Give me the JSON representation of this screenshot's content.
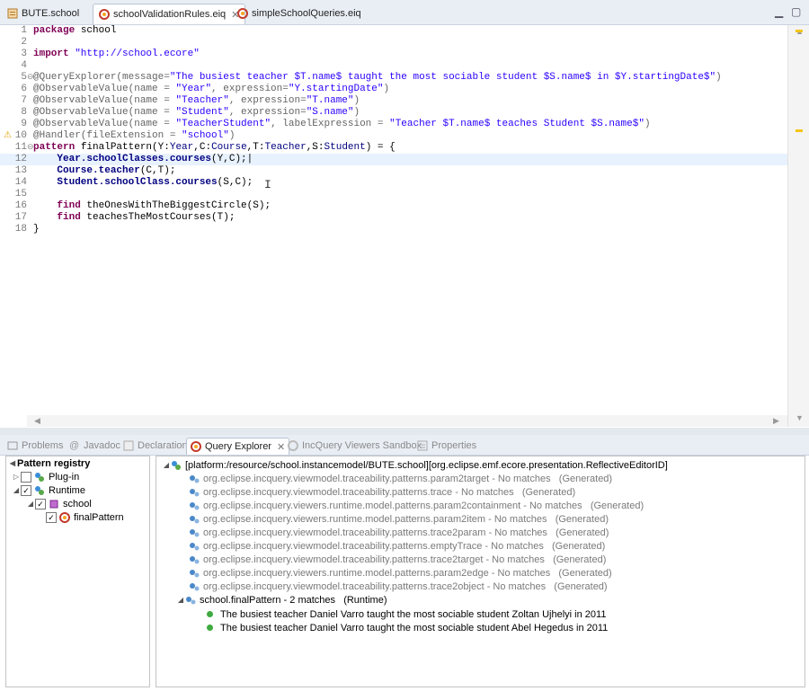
{
  "tabs": [
    {
      "label": "BUTE.school"
    },
    {
      "label": "schoolValidationRules.eiq"
    },
    {
      "label": "simpleSchoolQueries.eiq"
    }
  ],
  "editor": {
    "lines": [
      {
        "n": "1"
      },
      {
        "n": "2"
      },
      {
        "n": "3"
      },
      {
        "n": "4"
      },
      {
        "n": "5"
      },
      {
        "n": "6"
      },
      {
        "n": "7"
      },
      {
        "n": "8"
      },
      {
        "n": "9"
      },
      {
        "n": "10"
      },
      {
        "n": "11"
      },
      {
        "n": "12"
      },
      {
        "n": "13"
      },
      {
        "n": "14"
      },
      {
        "n": "15"
      },
      {
        "n": "16"
      },
      {
        "n": "17"
      },
      {
        "n": "18"
      }
    ],
    "t": {
      "package_kw": "package",
      "package_name": " school",
      "import_kw": "import",
      "import_str": " \"http://school.ecore\"",
      "l5a": "@QueryExplorer(message=",
      "l5b": "\"The busiest teacher $T.name$ taught the most sociable student $S.name$ in $Y.startingDate$\"",
      "l5c": ")",
      "l6a": "@ObservableValue(name = ",
      "l6b": "\"Year\"",
      "l6c": ", expression=",
      "l6d": "\"Y.startingDate\"",
      "l6e": ")",
      "l7a": "@ObservableValue(name = ",
      "l7b": "\"Teacher\"",
      "l7c": ", expression=",
      "l7d": "\"T.name\"",
      "l7e": ")",
      "l8a": "@ObservableValue(name = ",
      "l8b": "\"Student\"",
      "l8c": ", expression=",
      "l8d": "\"S.name\"",
      "l8e": ")",
      "l9a": "@ObservableValue(name = ",
      "l9b": "\"TeacherStudent\"",
      "l9c": ", labelExpression = ",
      "l9d": "\"Teacher $T.name$ teaches Student $S.name$\"",
      "l9e": ")",
      "l10a": "@Handler(fileExtension = ",
      "l10b": "\"school\"",
      "l10c": ")",
      "l11kw": "pattern",
      "l11a": " finalPattern(Y:",
      "l11b": "Year",
      "l11c": ",C:",
      "l11d": "Course",
      "l11e": ",T:",
      "l11f": "Teacher",
      "l11g": ",S:",
      "l11h": "Student",
      "l11i": ") = {",
      "l12a": "    Year.schoolClasses.courses",
      "l12b": "(Y,C);",
      "l13a": "    Course.teacher",
      "l13b": "(C,T);",
      "l14a": "    Student.schoolClass.courses",
      "l14b": "(S,C);",
      "l16kw": "    find",
      "l16b": " theOnesWithTheBiggestCircle(S);",
      "l17kw": "    find",
      "l17b": " teachesTheMostCourses(T);",
      "l18": "}"
    }
  },
  "views": [
    {
      "label": "Problems"
    },
    {
      "label": "Javadoc"
    },
    {
      "label": "Declaration"
    },
    {
      "label": "Query Explorer"
    },
    {
      "label": "IncQuery Viewers Sandbox"
    },
    {
      "label": "Properties"
    }
  ],
  "registry": {
    "title": "Pattern registry",
    "items": [
      {
        "label": "Plug-in"
      },
      {
        "label": "Runtime"
      },
      {
        "label": "school"
      },
      {
        "label": "finalPattern"
      }
    ]
  },
  "explorer": {
    "root": "[platform:/resource/school.instancemodel/BUTE.school][org.eclipse.emf.ecore.presentation.ReflectiveEditorID]",
    "patterns": [
      {
        "name": "org.eclipse.incquery.viewmodel.traceability.patterns.param2target - No matches",
        "tag": "(Generated)"
      },
      {
        "name": "org.eclipse.incquery.viewmodel.traceability.patterns.trace - No matches",
        "tag": "(Generated)"
      },
      {
        "name": "org.eclipse.incquery.viewers.runtime.model.patterns.param2containment - No matches",
        "tag": "(Generated)"
      },
      {
        "name": "org.eclipse.incquery.viewers.runtime.model.patterns.param2item - No matches",
        "tag": "(Generated)"
      },
      {
        "name": "org.eclipse.incquery.viewmodel.traceability.patterns.trace2param - No matches",
        "tag": "(Generated)"
      },
      {
        "name": "org.eclipse.incquery.viewmodel.traceability.patterns.emptyTrace - No matches",
        "tag": "(Generated)"
      },
      {
        "name": "org.eclipse.incquery.viewmodel.traceability.patterns.trace2target - No matches",
        "tag": "(Generated)"
      },
      {
        "name": "org.eclipse.incquery.viewers.runtime.model.patterns.param2edge - No matches",
        "tag": "(Generated)"
      },
      {
        "name": "org.eclipse.incquery.viewmodel.traceability.patterns.trace2object - No matches",
        "tag": "(Generated)"
      }
    ],
    "final": {
      "name": "school.finalPattern - 2 matches",
      "tag": "(Runtime)"
    },
    "matches": [
      {
        "text": "The busiest teacher Daniel Varro taught the most sociable student Zoltan Ujhelyi in 2011"
      },
      {
        "text": "The busiest teacher Daniel Varro taught the most sociable student Abel Hegedus in 2011"
      }
    ]
  }
}
